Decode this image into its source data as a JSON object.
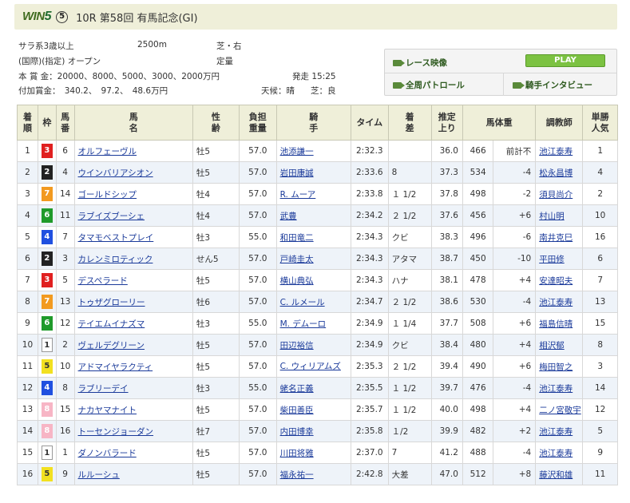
{
  "header": {
    "logo_text": "WIN",
    "logo_digit": "5",
    "race_num_circle": "⑤",
    "title": "10R 第58回 有馬記念(GI)"
  },
  "info": {
    "cond": "サラ系3歳以上",
    "distance": "2500m",
    "course": "芝・右",
    "class": "(国際)(指定) オープン",
    "weight_rule": "定量",
    "prize": "本 賞 金：20000、8000、5000、3000、2000万円",
    "start": "発走 15:25",
    "extra_prize": "付加賞金：　340.2、　97.2、　48.6万円",
    "weather": "天候：晴",
    "going": "芝：良"
  },
  "buttons": {
    "race_video": "レース映像",
    "play": "PLAY",
    "patrol": "全周パトロール",
    "interview": "騎手インタビュー"
  },
  "table": {
    "headers": [
      "着順",
      "枠",
      "馬番",
      "馬名",
      "性齢",
      "負担重量",
      "騎手",
      "タイム",
      "着差",
      "推定上り",
      "馬体重",
      "",
      "調教師",
      "単勝人気"
    ],
    "rows": [
      {
        "pos": "1",
        "waku": "3",
        "num": "6",
        "horse": "オルフェーヴル",
        "sex": "牡5",
        "wt": "57.0",
        "jockey": "池添謙一",
        "time": "2:32.3",
        "margin": "",
        "last": "36.0",
        "bw": "466",
        "bwd": "前計不",
        "trainer": "池江泰寿",
        "pop": "1"
      },
      {
        "pos": "2",
        "waku": "2",
        "num": "4",
        "horse": "ウインバリアシオン",
        "sex": "牡5",
        "wt": "57.0",
        "jockey": "岩田康誠",
        "time": "2:33.6",
        "margin": "8",
        "last": "37.3",
        "bw": "534",
        "bwd": "-4",
        "trainer": "松永昌博",
        "pop": "4"
      },
      {
        "pos": "3",
        "waku": "7",
        "num": "14",
        "horse": "ゴールドシップ",
        "sex": "牡4",
        "wt": "57.0",
        "jockey": "R. ムーア",
        "time": "2:33.8",
        "margin": "１ 1/2",
        "last": "37.8",
        "bw": "498",
        "bwd": "-2",
        "trainer": "須貝尚介",
        "pop": "2"
      },
      {
        "pos": "4",
        "waku": "6",
        "num": "11",
        "horse": "ラブイズブーシェ",
        "sex": "牡4",
        "wt": "57.0",
        "jockey": "武豊",
        "time": "2:34.2",
        "margin": "２ 1/2",
        "last": "37.6",
        "bw": "456",
        "bwd": "+6",
        "trainer": "村山明",
        "pop": "10"
      },
      {
        "pos": "5",
        "waku": "4",
        "num": "7",
        "horse": "タマモベストプレイ",
        "sex": "牡3",
        "wt": "55.0",
        "jockey": "和田竜二",
        "time": "2:34.3",
        "margin": "クビ",
        "last": "38.3",
        "bw": "496",
        "bwd": "-6",
        "trainer": "南井克巳",
        "pop": "16"
      },
      {
        "pos": "6",
        "waku": "2",
        "num": "3",
        "horse": "カレンミロティック",
        "sex": "せん5",
        "wt": "57.0",
        "jockey": "戸崎圭太",
        "time": "2:34.3",
        "margin": "アタマ",
        "last": "38.7",
        "bw": "450",
        "bwd": "-10",
        "trainer": "平田修",
        "pop": "6"
      },
      {
        "pos": "7",
        "waku": "3",
        "num": "5",
        "horse": "デスペラード",
        "sex": "牡5",
        "wt": "57.0",
        "jockey": "横山典弘",
        "time": "2:34.3",
        "margin": "ハナ",
        "last": "38.1",
        "bw": "478",
        "bwd": "+4",
        "trainer": "安達昭夫",
        "pop": "7"
      },
      {
        "pos": "8",
        "waku": "7",
        "num": "13",
        "horse": "トゥザグローリー",
        "sex": "牡6",
        "wt": "57.0",
        "jockey": "C. ルメール",
        "time": "2:34.7",
        "margin": "２ 1/2",
        "last": "38.6",
        "bw": "530",
        "bwd": "-4",
        "trainer": "池江泰寿",
        "pop": "13"
      },
      {
        "pos": "9",
        "waku": "6",
        "num": "12",
        "horse": "テイエムイナズマ",
        "sex": "牡3",
        "wt": "55.0",
        "jockey": "M. デムーロ",
        "time": "2:34.9",
        "margin": "１ 1/4",
        "last": "37.7",
        "bw": "508",
        "bwd": "+6",
        "trainer": "福島信晴",
        "pop": "15"
      },
      {
        "pos": "10",
        "waku": "1",
        "num": "2",
        "horse": "ヴェルデグリーン",
        "sex": "牡5",
        "wt": "57.0",
        "jockey": "田辺裕信",
        "time": "2:34.9",
        "margin": "クビ",
        "last": "38.4",
        "bw": "480",
        "bwd": "+4",
        "trainer": "相沢郁",
        "pop": "8"
      },
      {
        "pos": "11",
        "waku": "5",
        "num": "10",
        "horse": "アドマイヤラクティ",
        "sex": "牡5",
        "wt": "57.0",
        "jockey": "C. ウィリアムズ",
        "time": "2:35.3",
        "margin": "２ 1/2",
        "last": "39.4",
        "bw": "490",
        "bwd": "+6",
        "trainer": "梅田智之",
        "pop": "3"
      },
      {
        "pos": "12",
        "waku": "4",
        "num": "8",
        "horse": "ラブリーデイ",
        "sex": "牡3",
        "wt": "55.0",
        "jockey": "蛯名正義",
        "time": "2:35.5",
        "margin": "１ 1/2",
        "last": "39.7",
        "bw": "476",
        "bwd": "-4",
        "trainer": "池江泰寿",
        "pop": "14"
      },
      {
        "pos": "13",
        "waku": "8",
        "num": "15",
        "horse": "ナカヤマナイト",
        "sex": "牡5",
        "wt": "57.0",
        "jockey": "柴田善臣",
        "time": "2:35.7",
        "margin": "１ 1/2",
        "last": "40.0",
        "bw": "498",
        "bwd": "+4",
        "trainer": "二ノ宮敬宇",
        "pop": "12"
      },
      {
        "pos": "14",
        "waku": "8",
        "num": "16",
        "horse": "トーセンジョーダン",
        "sex": "牡7",
        "wt": "57.0",
        "jockey": "内田博幸",
        "time": "2:35.8",
        "margin": "１/2",
        "last": "39.9",
        "bw": "482",
        "bwd": "+2",
        "trainer": "池江泰寿",
        "pop": "5"
      },
      {
        "pos": "15",
        "waku": "1",
        "num": "1",
        "horse": "ダノンバラード",
        "sex": "牡5",
        "wt": "57.0",
        "jockey": "川田将雅",
        "time": "2:37.0",
        "margin": "7",
        "last": "41.2",
        "bw": "488",
        "bwd": "-4",
        "trainer": "池江泰寿",
        "pop": "9"
      },
      {
        "pos": "16",
        "waku": "5",
        "num": "9",
        "horse": "ルルーシュ",
        "sex": "牡5",
        "wt": "57.0",
        "jockey": "福永祐一",
        "time": "2:42.8",
        "margin": "大差",
        "last": "47.0",
        "bw": "512",
        "bwd": "+8",
        "trainer": "藤沢和雄",
        "pop": "11"
      }
    ]
  }
}
